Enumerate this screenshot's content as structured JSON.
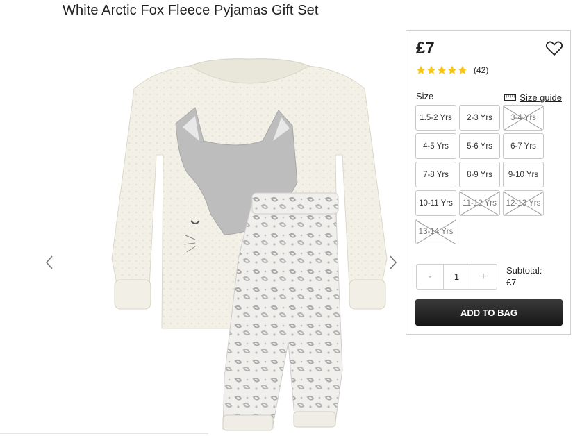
{
  "product": {
    "title": "White Arctic Fox Fleece Pyjamas Gift Set"
  },
  "purchase": {
    "price": "£7",
    "rating": 5,
    "review_count": "(42)",
    "size_label": "Size",
    "size_guide_label": "Size guide",
    "sizes": [
      {
        "label": "1.5-2 Yrs",
        "available": true
      },
      {
        "label": "2-3 Yrs",
        "available": true
      },
      {
        "label": "3-4 Yrs",
        "available": false
      },
      {
        "label": "4-5 Yrs",
        "available": true
      },
      {
        "label": "5-6 Yrs",
        "available": true
      },
      {
        "label": "6-7 Yrs",
        "available": true
      },
      {
        "label": "7-8 Yrs",
        "available": true
      },
      {
        "label": "8-9 Yrs",
        "available": true
      },
      {
        "label": "9-10 Yrs",
        "available": true
      },
      {
        "label": "10-11 Yrs",
        "available": true
      },
      {
        "label": "11-12 Yrs",
        "available": false
      },
      {
        "label": "12-13 Yrs",
        "available": false
      },
      {
        "label": "13-14 Yrs",
        "available": false
      }
    ],
    "quantity": {
      "decrement": "-",
      "value": "1",
      "increment": "+"
    },
    "subtotal_label": "Subtotal:",
    "subtotal_value": "£7",
    "add_to_bag": "ADD TO BAG"
  },
  "icons": {
    "wishlist": "heart-icon",
    "size_guide": "ruler-icon",
    "prev": "chevron-left-icon",
    "next": "chevron-right-icon",
    "star": "star-icon"
  },
  "colors": {
    "star": "#f5c518",
    "button": "#222222"
  }
}
